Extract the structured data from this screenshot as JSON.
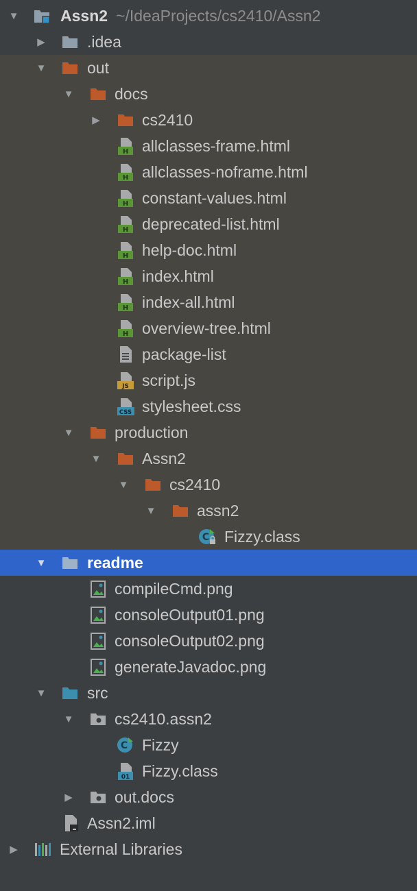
{
  "project": {
    "name": "Assn2",
    "path": "~/IdeaProjects/cs2410/Assn2"
  },
  "folders": {
    "idea": ".idea",
    "out": "out",
    "docs": "docs",
    "docs_cs2410": "cs2410",
    "production": "production",
    "prod_assn2": "Assn2",
    "prod_cs2410": "cs2410",
    "prod_assn2_pkg": "assn2",
    "readme": "readme",
    "src": "src",
    "src_pkg": "cs2410.assn2",
    "out_docs": "out.docs"
  },
  "files": {
    "allclasses_frame": "allclasses-frame.html",
    "allclasses_noframe": "allclasses-noframe.html",
    "constant_values": "constant-values.html",
    "deprecated_list": "deprecated-list.html",
    "help_doc": "help-doc.html",
    "index": "index.html",
    "index_all": "index-all.html",
    "overview_tree": "overview-tree.html",
    "package_list": "package-list",
    "script_js": "script.js",
    "stylesheet_css": "stylesheet.css",
    "prod_fizzy_class": "Fizzy.class",
    "compile_cmd": "compileCmd.png",
    "console_output_01": "consoleOutput01.png",
    "console_output_02": "consoleOutput02.png",
    "generate_javadoc": "generateJavadoc.png",
    "fizzy": "Fizzy",
    "src_fizzy_class": "Fizzy.class",
    "iml": "Assn2.iml"
  },
  "external_libraries": "External Libraries",
  "icon_badges": {
    "html": "H",
    "js": "JS",
    "css": "CSS",
    "binary": "01"
  },
  "colors": {
    "selection": "#2f65ca",
    "excluded_folder": "#bd5a2c",
    "source_folder": "#3d8fb0",
    "html_badge": "#5a9636",
    "js_badge": "#c79b38",
    "background": "#3c3f41"
  }
}
